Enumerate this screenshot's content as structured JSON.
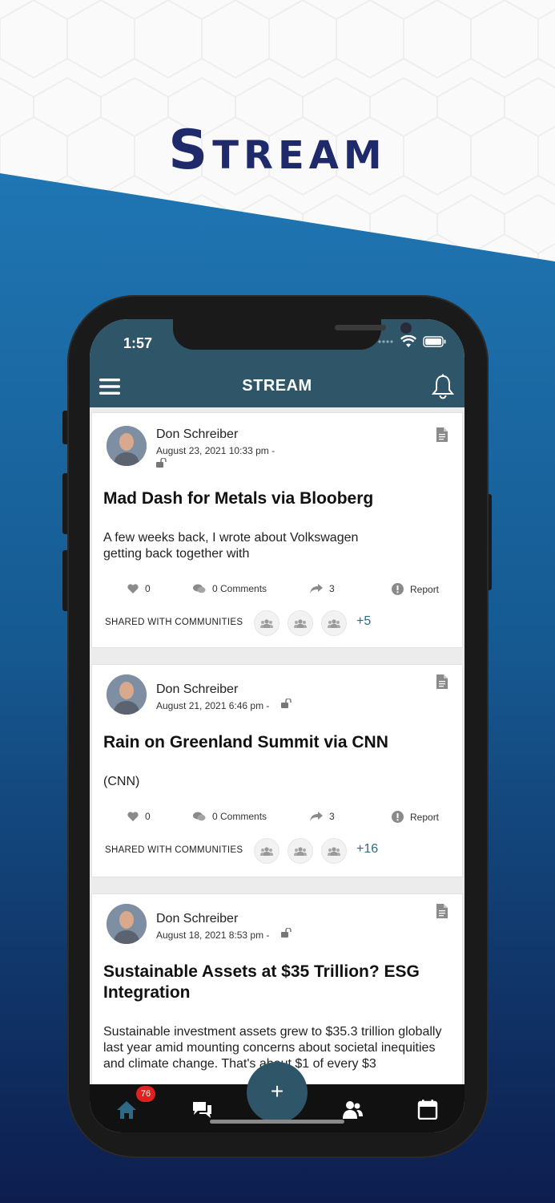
{
  "brand": {
    "logo_first": "S",
    "logo_rest": "TREAM",
    "logo_color": "#1f2a6b"
  },
  "status_bar": {
    "time": "1:57"
  },
  "header": {
    "title": "STREAM",
    "color": "#2e5568"
  },
  "posts": [
    {
      "author": "Don Schreiber",
      "date": "August 23, 2021 10:33 pm -",
      "title": "Mad Dash for Metals via Blooberg",
      "body": "A few weeks back, I wrote about Volkswagen getting back together with",
      "likes": "0",
      "comments": "0 Comments",
      "shares": "3",
      "report": "Report",
      "shared_label": "SHARED WITH COMMUNITIES",
      "more_communities": "+5"
    },
    {
      "author": "Don Schreiber",
      "date": "August 21, 2021 6:46 pm -",
      "title": "Rain on Greenland Summit via CNN",
      "body": "(CNN)",
      "likes": "0",
      "comments": "0 Comments",
      "shares": "3",
      "report": "Report",
      "shared_label": "SHARED WITH COMMUNITIES",
      "more_communities": "+16"
    },
    {
      "author": "Don Schreiber",
      "date": "August 18, 2021 8:53 pm -",
      "title": "Sustainable Assets at $35 Trillion? ESG Integration",
      "body": "Sustainable investment assets grew to $35.3 trillion globally last year amid mounting concerns about societal inequities and climate change. That's about $1 of every $3"
    }
  ],
  "tab_bar": {
    "home_badge": "76",
    "fab_label": "+"
  }
}
